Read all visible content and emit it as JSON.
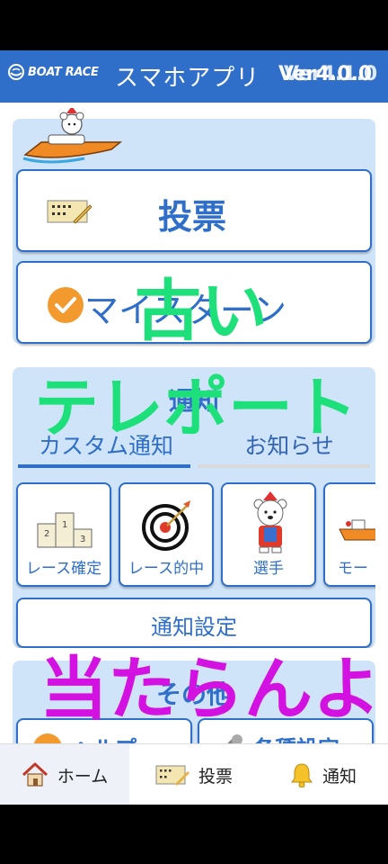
{
  "header": {
    "logo_text": "BOAT RACE",
    "title": "スマホアプリ",
    "version_a": "Ver4.0.0",
    "version_b": "Ver4.1.0"
  },
  "main": {
    "vote_label": "投票",
    "myschedule_label": "マイスターン",
    "notify": {
      "title": "通知",
      "tabs": [
        {
          "label": "カスタム通知",
          "active": true
        },
        {
          "label": "お知らせ",
          "active": false
        }
      ],
      "cards": [
        {
          "label": "レース確定",
          "icon": "podium-icon"
        },
        {
          "label": "レース的中",
          "icon": "target-icon"
        },
        {
          "label": "選手",
          "icon": "bear-mascot-icon"
        },
        {
          "label": "モー",
          "icon": "boat-icon"
        }
      ],
      "settings_label": "通知設定"
    },
    "other": {
      "title": "その他",
      "items": [
        {
          "label": "ヘルプ",
          "icon": "help-icon"
        },
        {
          "label": "各種設定",
          "icon": "settings-icon"
        }
      ]
    }
  },
  "overlays": {
    "text1": "古い",
    "text2": "テレポート",
    "text3": "当たらんよ"
  },
  "tabbar": {
    "items": [
      {
        "label": "ホーム",
        "icon": "home-icon",
        "active": true
      },
      {
        "label": "投票",
        "icon": "ticket-icon",
        "active": false
      },
      {
        "label": "通知",
        "icon": "bell-icon",
        "active": false
      }
    ]
  },
  "colors": {
    "accent": "#2f6fc9",
    "panel": "#cfe4f8",
    "overlay_green": "#1ee07a",
    "overlay_magenta": "#d311e0"
  }
}
